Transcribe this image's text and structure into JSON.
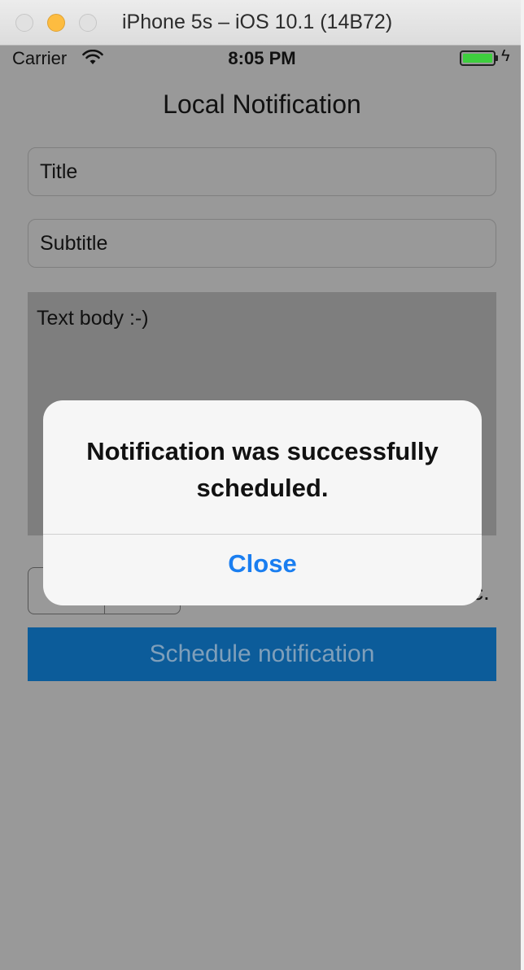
{
  "window": {
    "title": "iPhone 5s – iOS 10.1 (14B72)"
  },
  "status_bar": {
    "carrier": "Carrier",
    "time": "8:05 PM",
    "icons": [
      "wifi-icon",
      "battery-icon",
      "charging-bolt-icon"
    ],
    "battery_color": "#3ecf3e"
  },
  "app": {
    "title": "Local Notification",
    "title_field": {
      "placeholder": "Title"
    },
    "subtitle_field": {
      "placeholder": "Subtitle"
    },
    "body_text": "Text body :-)",
    "sec_label_fragment": "c.",
    "schedule_button": "Schedule notification",
    "accent": "#0c5c9a"
  },
  "alert": {
    "message": "Notification was successfully scheduled.",
    "close_label": "Close",
    "button_color": "#1a7ef0"
  }
}
